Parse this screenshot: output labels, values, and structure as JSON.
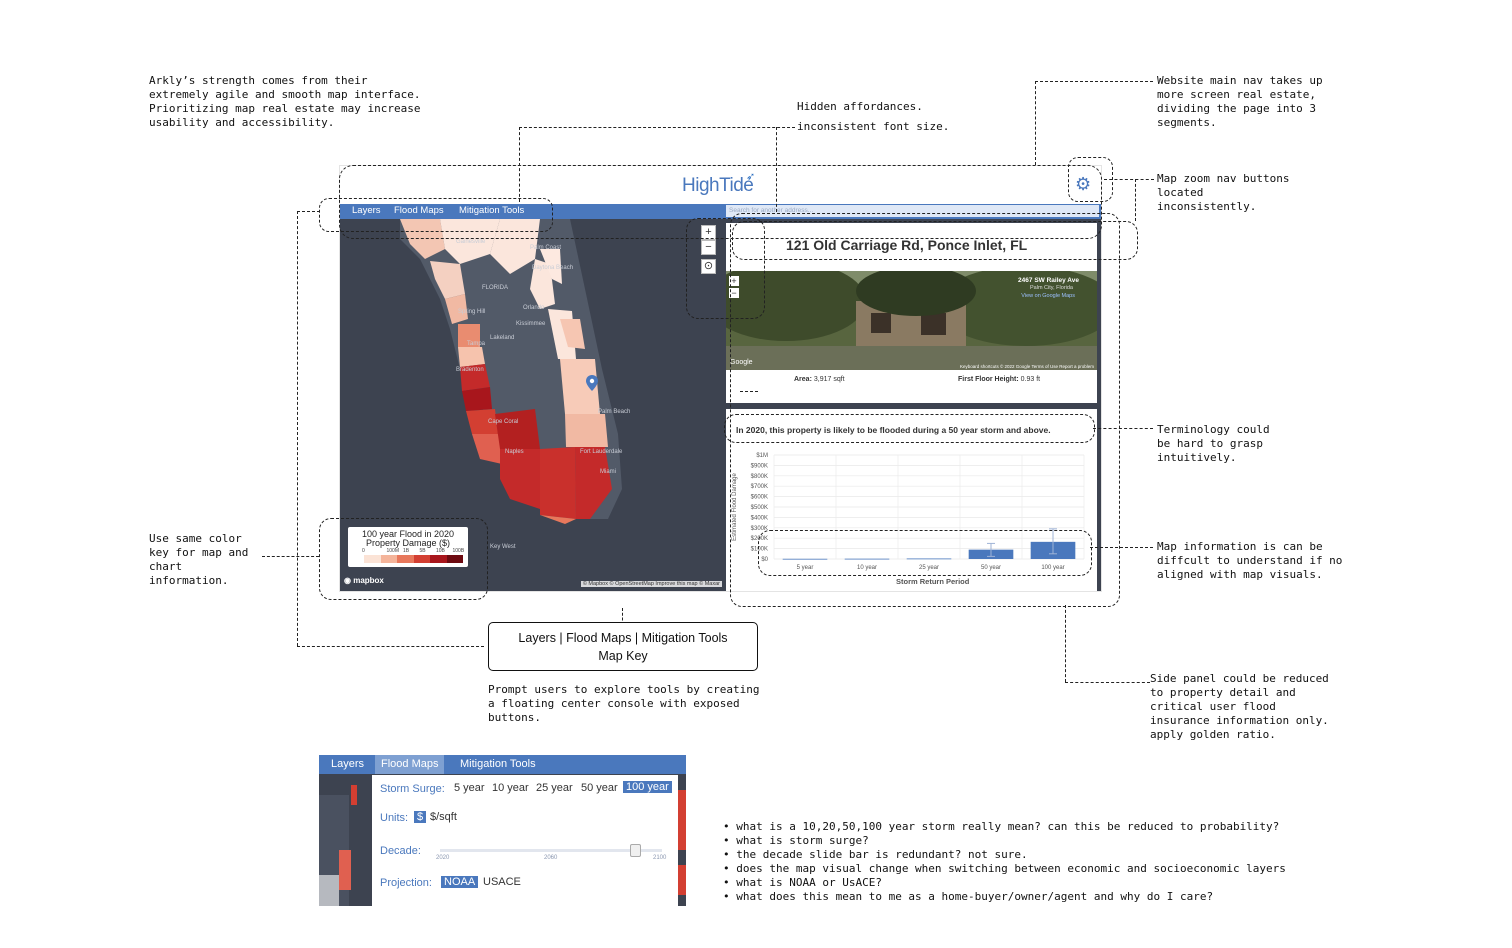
{
  "annotations": {
    "arkly": "Arkly’s strength comes from their\nextremely agile and smooth map interface.\nPrioritizing map real estate may increase\nusability and accessibility.",
    "hidden_affordances": "Hidden affordances.",
    "inconsistent_font": "inconsistent font size.",
    "main_nav": "Website main nav takes up\nmore screen real estate,\ndividing the page into 3\nsegments.",
    "zoom_nav": "Map zoom nav buttons\nlocated\ninconsistently.",
    "terminology": "Terminology could\nbe hard to grasp\nintuitively.",
    "map_info": "Map information is can be\ndiffcult to understand if no\naligned with map visuals.",
    "side_panel": "Side panel could be reduced\nto property detail and\ncritical user flood\ninsurance information only.\napply golden ratio.",
    "color_key": "Use same color\nkey for map and\nchart\ninformation.",
    "prompt_users": "Prompt users to explore tools by creating\na floating center console with exposed\nbuttons."
  },
  "console_box": {
    "line1": "Layers | Flood Maps | Mitigation Tools",
    "line2": "Map Key"
  },
  "questions": [
    "what is a 10,20,50,100 year storm really mean? can this be reduced to probability?",
    "what is storm surge?",
    "the decade slide bar is redundant? not sure.",
    "does the map visual change when switching between economic and socioeconomic layers",
    "what is NOAA or UsACE?",
    "what does this mean to me as a home-buyer/owner/agent and why do I care?"
  ],
  "app": {
    "logo": "HighTide",
    "nav": [
      "Layers",
      "Flood Maps",
      "Mitigation Tools"
    ],
    "search_placeholder": "Search for another address...",
    "map": {
      "cities": [
        "Gainesville",
        "Palm Coast",
        "Daytona Beach",
        "FLORIDA",
        "Orlando",
        "Spring Hill",
        "Kissimmee",
        "Lakeland",
        "Tampa",
        "Bradenton",
        "Cape Coral",
        "Naples",
        "Fort Lauderdale",
        "Miami",
        "Palm Beach",
        "Key West"
      ],
      "legend_title": "100 year Flood in 2020",
      "legend_subtitle": "Property Damage ($)",
      "legend_ticks": [
        "0",
        "100M",
        "1B",
        "5B",
        "10B",
        "100B"
      ],
      "legend_colors": [
        "#fbe3d6",
        "#f4b49a",
        "#e8785c",
        "#d33f32",
        "#a8161c",
        "#6d0a10"
      ],
      "mapbox": "mapbox",
      "attribution": "© Mapbox © OpenStreetMap Improve this map © Maxar"
    },
    "property": {
      "address": "121 Old Carriage Rd, Ponce Inlet, FL",
      "streetview_label": "2467 SW Railey Ave",
      "streetview_sub": "Palm City, Florida",
      "streetview_link": "View on Google Maps",
      "google": "Google",
      "streetview_footer": "Keyboard shortcuts  © 2022 Google  Terms of Use  Report a problem",
      "area_label": "Area:",
      "area_value": "3,917 sqft",
      "floor_label": "First Floor Height:",
      "floor_value": "0.93 ft"
    },
    "flood_message": "In 2020, this property is likely to be flooded during a 50 year storm and above.",
    "chart_ylabel": "Estimated Flood Damage"
  },
  "chart_data": {
    "type": "bar",
    "categories": [
      "5 year",
      "10 year",
      "25 year",
      "50 year",
      "100 year"
    ],
    "values": [
      2000,
      3000,
      5000,
      90000,
      165000
    ],
    "error_high": [
      0,
      0,
      0,
      150000,
      290000
    ],
    "error_low": [
      0,
      0,
      0,
      25000,
      50000
    ],
    "y_ticks": [
      "$0",
      "$100K",
      "$200K",
      "$300K",
      "$400K",
      "$500K",
      "$600K",
      "$700K",
      "$800K",
      "$900K",
      "$1M"
    ],
    "xlabel": "Storm Return Period",
    "ylabel": "Estimated Flood Damage",
    "ylim": [
      0,
      1000000
    ],
    "bar_color": "#4a78bd"
  },
  "mini_panel": {
    "tabs": [
      "Layers",
      "Flood Maps",
      "Mitigation Tools"
    ],
    "storm_surge_label": "Storm Surge:",
    "storm_options": [
      "5 year",
      "10 year",
      "25 year",
      "50 year",
      "100 year"
    ],
    "storm_selected": "100 year",
    "units_label": "Units:",
    "units_options": [
      "$",
      "$/sqft"
    ],
    "decade_label": "Decade:",
    "decade_ticks": [
      "2020",
      "2060",
      "2100"
    ],
    "decade_value": 2090,
    "projection_label": "Projection:",
    "projection_options": [
      "NOAA",
      "USACE"
    ]
  }
}
